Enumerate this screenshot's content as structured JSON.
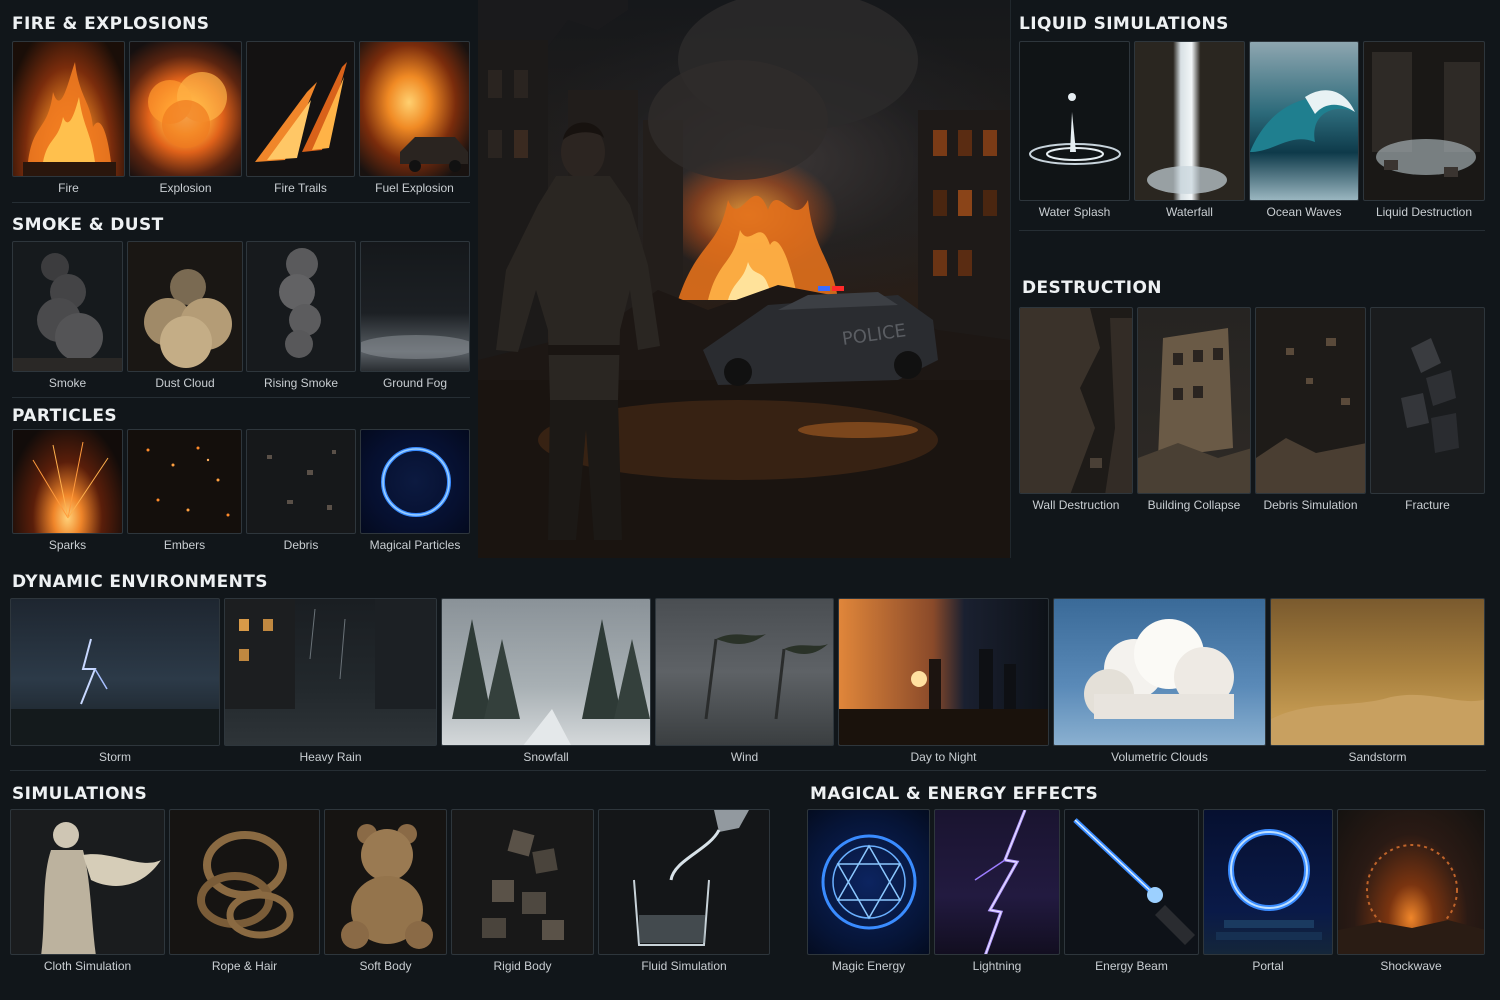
{
  "sections": {
    "fire": {
      "title": "FIRE & EXPLOSIONS",
      "items": [
        {
          "label": "Fire",
          "icon": "fire-icon"
        },
        {
          "label": "Explosion",
          "icon": "explosion-icon"
        },
        {
          "label": "Fire Trails",
          "icon": "fire-trails-icon"
        },
        {
          "label": "Fuel Explosion",
          "icon": "fuel-explosion-icon"
        }
      ]
    },
    "smoke": {
      "title": "SMOKE & DUST",
      "items": [
        {
          "label": "Smoke",
          "icon": "smoke-icon"
        },
        {
          "label": "Dust Cloud",
          "icon": "dust-cloud-icon"
        },
        {
          "label": "Rising Smoke",
          "icon": "rising-smoke-icon"
        },
        {
          "label": "Ground Fog",
          "icon": "ground-fog-icon"
        }
      ]
    },
    "particles": {
      "title": "PARTICLES",
      "items": [
        {
          "label": "Sparks",
          "icon": "sparks-icon"
        },
        {
          "label": "Embers",
          "icon": "embers-icon"
        },
        {
          "label": "Debris",
          "icon": "debris-icon"
        },
        {
          "label": "Magical Particles",
          "icon": "magical-particles-icon"
        }
      ]
    },
    "liquid": {
      "title": "LIQUID SIMULATIONS",
      "items": [
        {
          "label": "Water Splash",
          "icon": "water-splash-icon"
        },
        {
          "label": "Waterfall",
          "icon": "waterfall-icon"
        },
        {
          "label": "Ocean Waves",
          "icon": "ocean-waves-icon"
        },
        {
          "label": "Liquid Destruction",
          "icon": "liquid-destruction-icon"
        }
      ]
    },
    "destruction": {
      "title": "DESTRUCTION",
      "items": [
        {
          "label": "Wall Destruction",
          "icon": "wall-destruction-icon"
        },
        {
          "label": "Building Collapse",
          "icon": "building-collapse-icon"
        },
        {
          "label": "Debris Simulation",
          "icon": "debris-simulation-icon"
        },
        {
          "label": "Fracture",
          "icon": "fracture-icon"
        }
      ]
    },
    "environments": {
      "title": "DYNAMIC ENVIRONMENTS",
      "items": [
        {
          "label": "Storm",
          "icon": "storm-icon"
        },
        {
          "label": "Heavy Rain",
          "icon": "heavy-rain-icon"
        },
        {
          "label": "Snowfall",
          "icon": "snowfall-icon"
        },
        {
          "label": "Wind",
          "icon": "wind-icon"
        },
        {
          "label": "Day to Night",
          "icon": "day-to-night-icon"
        },
        {
          "label": "Volumetric Clouds",
          "icon": "volumetric-clouds-icon"
        },
        {
          "label": "Sandstorm",
          "icon": "sandstorm-icon"
        }
      ]
    },
    "simulations": {
      "title": "SIMULATIONS",
      "items": [
        {
          "label": "Cloth Simulation",
          "icon": "cloth-simulation-icon"
        },
        {
          "label": "Rope & Hair",
          "icon": "rope-hair-icon"
        },
        {
          "label": "Soft Body",
          "icon": "soft-body-icon"
        },
        {
          "label": "Rigid Body",
          "icon": "rigid-body-icon"
        },
        {
          "label": "Fluid Simulation",
          "icon": "fluid-simulation-icon"
        }
      ]
    },
    "magical": {
      "title": "MAGICAL & ENERGY EFFECTS",
      "items": [
        {
          "label": "Magic Energy",
          "icon": "magic-energy-icon"
        },
        {
          "label": "Lightning",
          "icon": "lightning-icon"
        },
        {
          "label": "Energy Beam",
          "icon": "energy-beam-icon"
        },
        {
          "label": "Portal",
          "icon": "portal-icon"
        },
        {
          "label": "Shockwave",
          "icon": "shockwave-icon"
        }
      ]
    }
  },
  "hero": {
    "icon": "city-fire-scene-icon",
    "car_text": "POLICE"
  },
  "colors": {
    "background": "#11161a",
    "fire": "#f08a24",
    "magic": "#3a8cff",
    "lightning": "#9c7cff",
    "text": "#d9dde0"
  }
}
